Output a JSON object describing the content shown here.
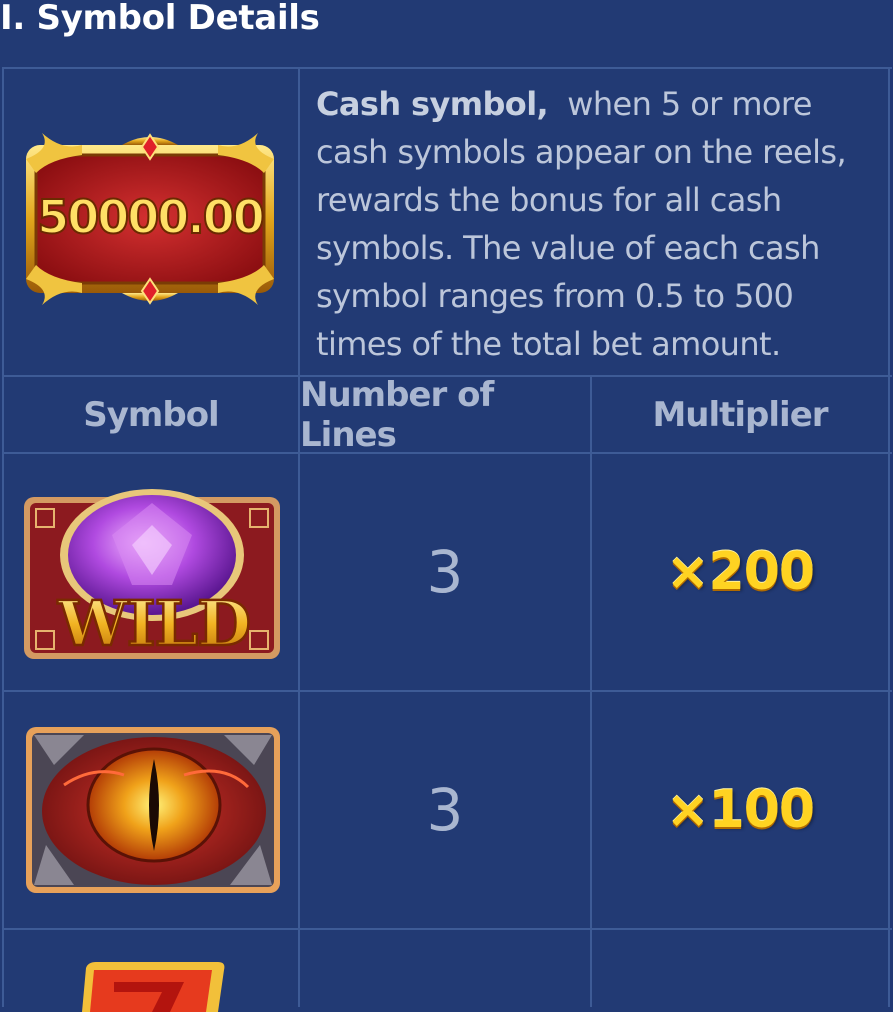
{
  "section": {
    "title": "I. Symbol Details"
  },
  "cash": {
    "symbol_value": "50000.00",
    "title": "Cash symbol,",
    "description": "when 5 or more cash symbols appear on the reels, rewards the bonus for all cash symbols. The value of each cash symbol ranges from 0.5 to 500 times of the total bet amount."
  },
  "table": {
    "headers": [
      "Symbol",
      "Number of Lines",
      "Multiplier"
    ],
    "rows": [
      {
        "symbol": "wild-symbol",
        "symbol_text": "WILD",
        "lines": "3",
        "multiplier": "×200"
      },
      {
        "symbol": "dragon-eye-symbol",
        "lines": "3",
        "multiplier": "×100"
      },
      {
        "symbol": "red-seven-symbol",
        "lines": "",
        "multiplier": ""
      }
    ]
  },
  "colors": {
    "background": "#223a74",
    "grid_line": "#3e5b96",
    "multiplier_gold": "#ffd322",
    "header_text": "#a9b6d0"
  }
}
